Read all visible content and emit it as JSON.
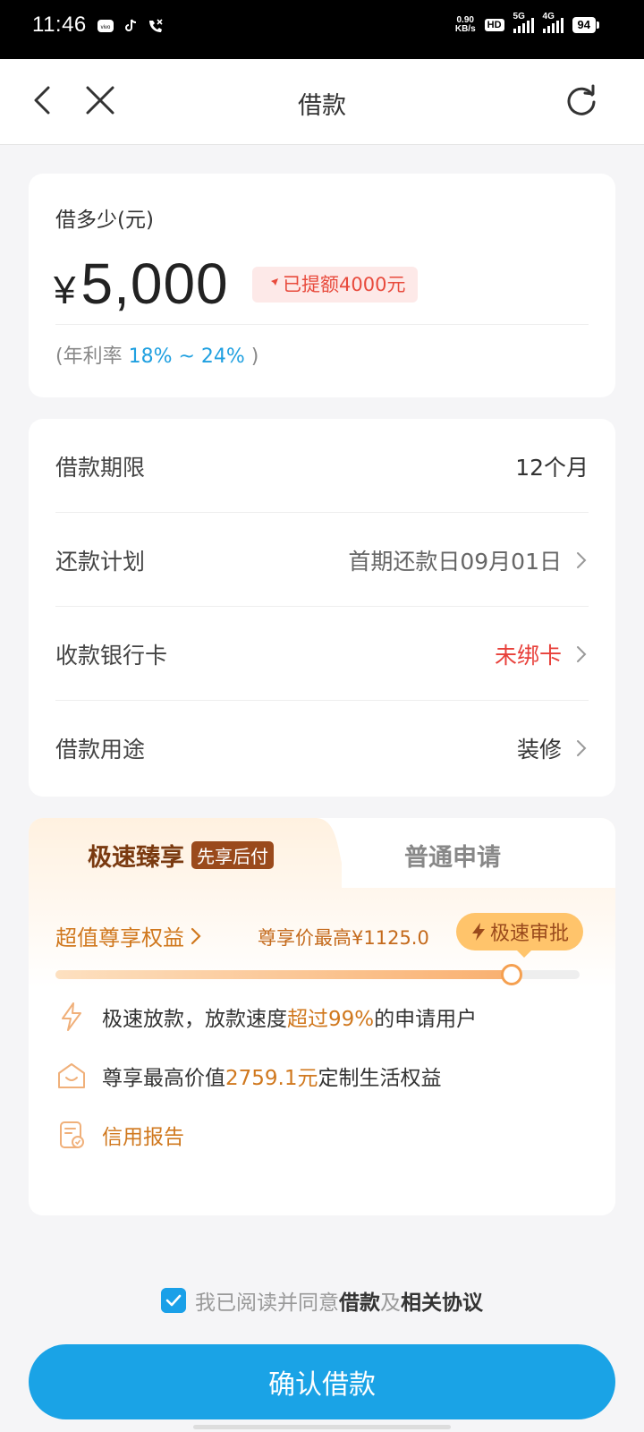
{
  "status_bar": {
    "time": "11:46",
    "net_speed_top": "0.90",
    "net_speed_bottom": "KB/s",
    "hd": "HD",
    "sig1": "5G",
    "sig2": "4G",
    "battery": "94"
  },
  "header": {
    "title": "借款"
  },
  "amount_card": {
    "label": "借多少(元)",
    "currency": "¥",
    "amount": "5,000",
    "limit_badge": "已提额4000元",
    "rate_prefix": "(年利率 ",
    "rate_range": "18% ~ 24%",
    "rate_suffix": " )"
  },
  "details": [
    {
      "label": "借款期限",
      "value": "12个月"
    },
    {
      "label": "还款计划",
      "value": "首期还款日09月01日"
    },
    {
      "label": "收款银行卡",
      "value": "未绑卡"
    },
    {
      "label": "借款用途",
      "value": "装修"
    }
  ],
  "plan_card": {
    "tab_active": "极速臻享",
    "tab_active_tag": "先享后付",
    "tab_inactive": "普通申请",
    "perk_link": "超值尊享权益",
    "perk_price": "尊享价最高¥1125.0",
    "fast_pill": "极速审批",
    "slider_level": 0.87,
    "features": [
      {
        "pre": "极速放款，放款速度",
        "hl": "超过99%",
        "post": "的申请用户"
      },
      {
        "pre": "尊享最高价值",
        "hl": "2759.1元",
        "post": "定制生活权益"
      },
      {
        "pre": "",
        "hl": "信用报告",
        "post": ""
      }
    ]
  },
  "agreement": {
    "pre": "我已阅读并同意",
    "link1": "借款",
    "mid": "及",
    "link2": "相关协议"
  },
  "confirm_button": "确认借款",
  "colors": {
    "primary": "#1aa3e6",
    "accent_orange": "#d0781e",
    "danger": "#e8403a"
  }
}
